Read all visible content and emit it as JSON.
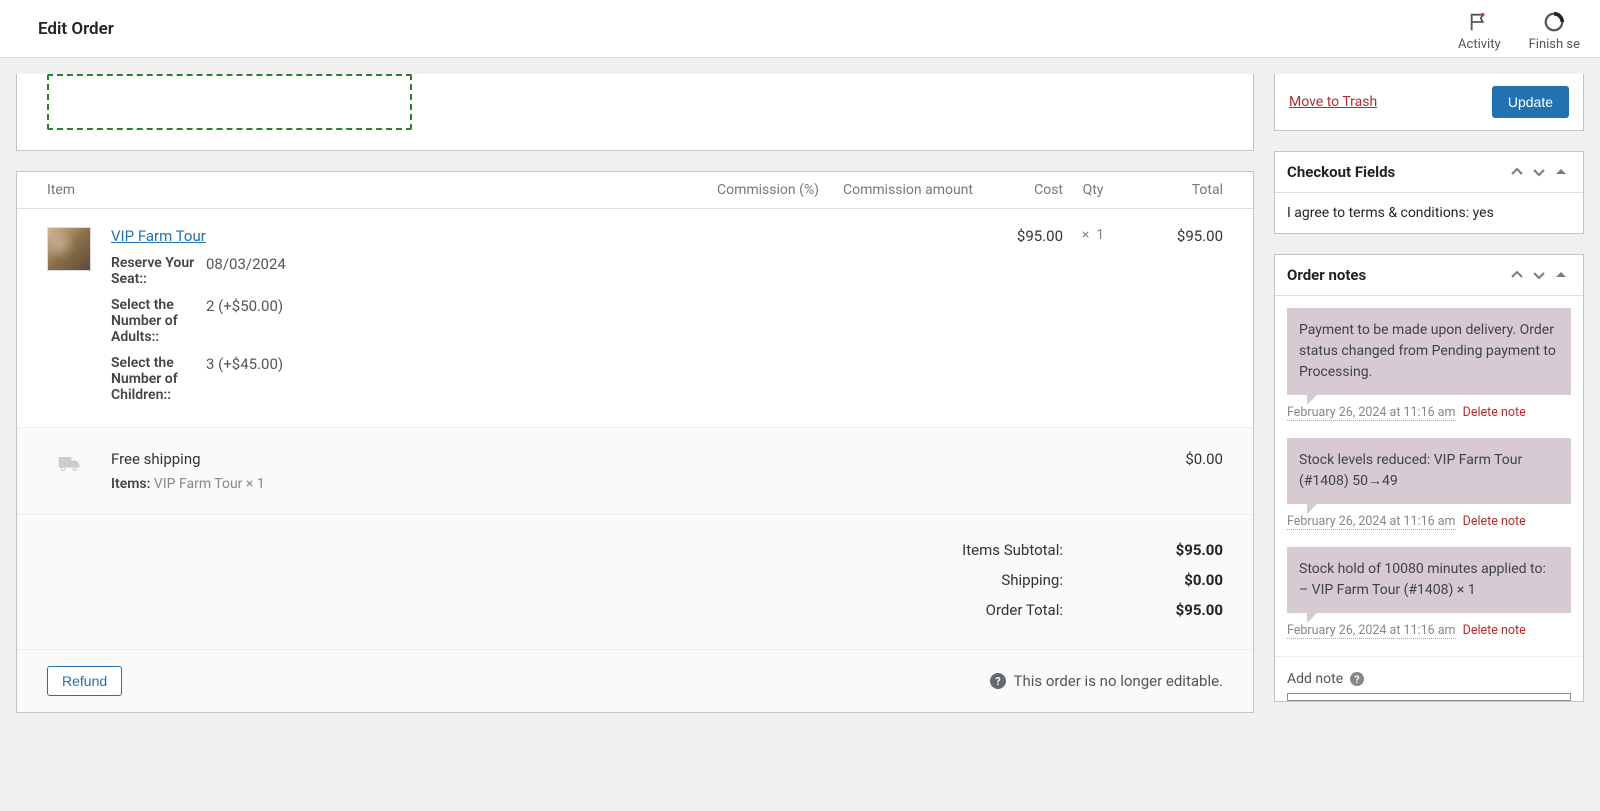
{
  "topbar": {
    "title": "Edit Order",
    "activity_label": "Activity",
    "finish_label": "Finish se"
  },
  "items_panel": {
    "headers": {
      "item": "Item",
      "commission_pct": "Commission (%)",
      "commission_amt": "Commission amount",
      "cost": "Cost",
      "qty": "Qty",
      "total": "Total"
    },
    "line_items": [
      {
        "name": "VIP Farm Tour",
        "meta": [
          {
            "label": "Reserve Your Seat::",
            "value": "08/03/2024"
          },
          {
            "label": "Select the Number of Adults::",
            "value": "2 (+$50.00)"
          },
          {
            "label": "Select the Number of Children::",
            "value": "3 (+$45.00)"
          }
        ],
        "cost": "$95.00",
        "qty_prefix": "×",
        "qty": "1",
        "total": "$95.00"
      }
    ],
    "shipping": {
      "name": "Free shipping",
      "items_label": "Items:",
      "items_value": "VIP Farm Tour × 1",
      "total": "$0.00"
    },
    "totals": [
      {
        "label": "Items Subtotal:",
        "value": "$95.00"
      },
      {
        "label": "Shipping:",
        "value": "$0.00"
      },
      {
        "label": "Order Total:",
        "value": "$95.00"
      }
    ],
    "refund_btn": "Refund",
    "not_editable": "This order is no longer editable."
  },
  "sidebar": {
    "trash": "Move to Trash",
    "update": "Update",
    "checkout_fields": {
      "title": "Checkout Fields",
      "body": "I agree to terms & conditions: yes"
    },
    "order_notes": {
      "title": "Order notes",
      "notes": [
        {
          "text": "Payment to be made upon delivery. Order status changed from Pending payment to Processing.",
          "date": "February 26, 2024 at 11:16 am",
          "delete": "Delete note"
        },
        {
          "text": "Stock levels reduced: VIP Farm Tour (#1408) 50→49",
          "date": "February 26, 2024 at 11:16 am",
          "delete": "Delete note"
        },
        {
          "text": "Stock hold of 10080 minutes applied to:\n– VIP Farm Tour (#1408) × 1",
          "date": "February 26, 2024 at 11:16 am",
          "delete": "Delete note"
        }
      ],
      "add_label": "Add note"
    }
  }
}
